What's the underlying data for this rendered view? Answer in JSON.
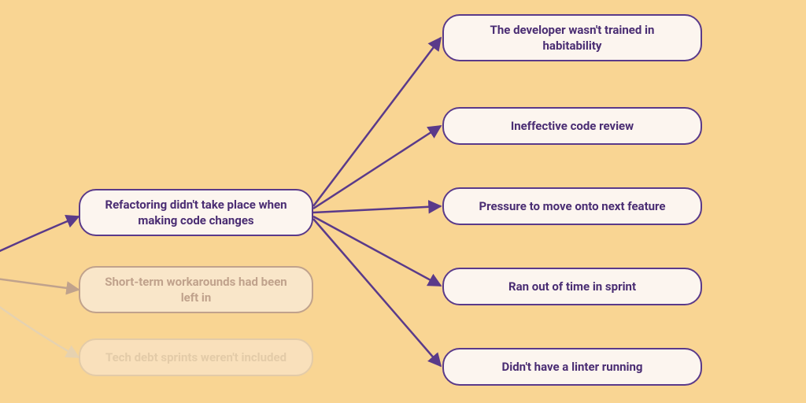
{
  "diagram": {
    "type": "cause-tree",
    "colors": {
      "background": "#f9d593",
      "node_bg": "#fcf5ef",
      "node_border": "#5a3a8a",
      "node_text": "#4a2d73",
      "faded1_border": "#c0a28c",
      "faded2_border": "#e3cba8",
      "arrow": "#5a3a8a",
      "arrow_faded1": "#c0a28c",
      "arrow_faded2": "#e6d2b0"
    },
    "left_column": {
      "main": {
        "label": "Refactoring didn't take place when making code changes"
      },
      "faded1": {
        "label": "Short-term workarounds had been left in"
      },
      "faded2": {
        "label": "Tech debt sprints weren't included"
      }
    },
    "right_column": [
      {
        "label": "The developer wasn't trained in habitability"
      },
      {
        "label": "Ineffective code review"
      },
      {
        "label": "Pressure to move onto next feature"
      },
      {
        "label": "Ran out of time in sprint"
      },
      {
        "label": "Didn't have a linter running"
      }
    ]
  }
}
